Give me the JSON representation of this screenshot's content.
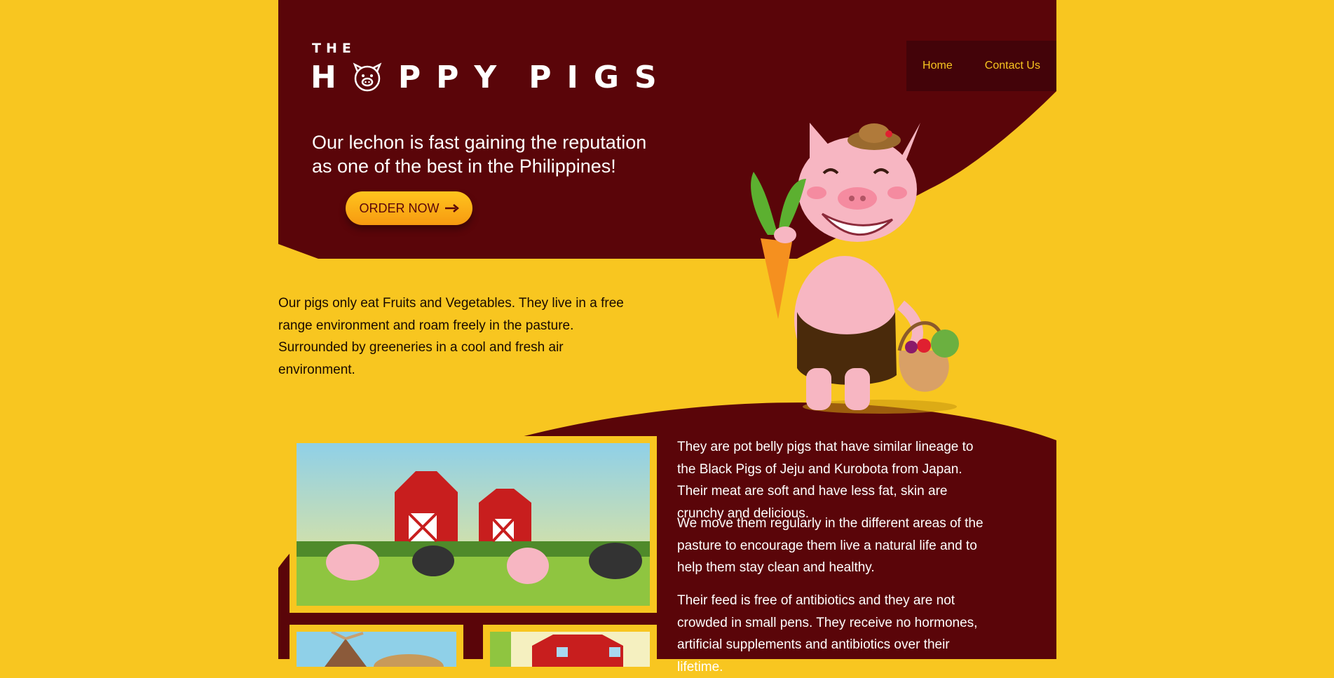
{
  "brand": {
    "the": "THE",
    "letters": [
      "H",
      "P",
      "P",
      "Y",
      "P",
      "I",
      "G",
      "S"
    ]
  },
  "nav": {
    "home": "Home",
    "contact": "Contact Us"
  },
  "hero": {
    "tagline": "Our lechon is fast gaining the reputation as one of the best in the Philippines!",
    "cta_label": "ORDER NOW",
    "cta_icon": "arrow-right-icon"
  },
  "intro": "Our pigs only eat Fruits and Vegetables. They live in a free range environment and roam freely in the pasture. Surrounded by greeneries in a cool and fresh air environment.",
  "details": [
    "They are pot belly pigs that have similar lineage to the Black Pigs of Jeju and Kurobota from Japan. Their meat are soft and have less fat, skin are crunchy and delicious.",
    "We move them regularly in the different areas of the pasture to encourage them live a natural life and to help them stay clean and healthy.",
    "Their feed is free of antibiotics and they are not crowded in small pens. They receive no hormones, artificial supplements and antibiotics over their lifetime."
  ],
  "colors": {
    "background": "#F8C620",
    "maroon": "#5A0509",
    "nav_bg": "#430309",
    "button": "#FFB218"
  }
}
